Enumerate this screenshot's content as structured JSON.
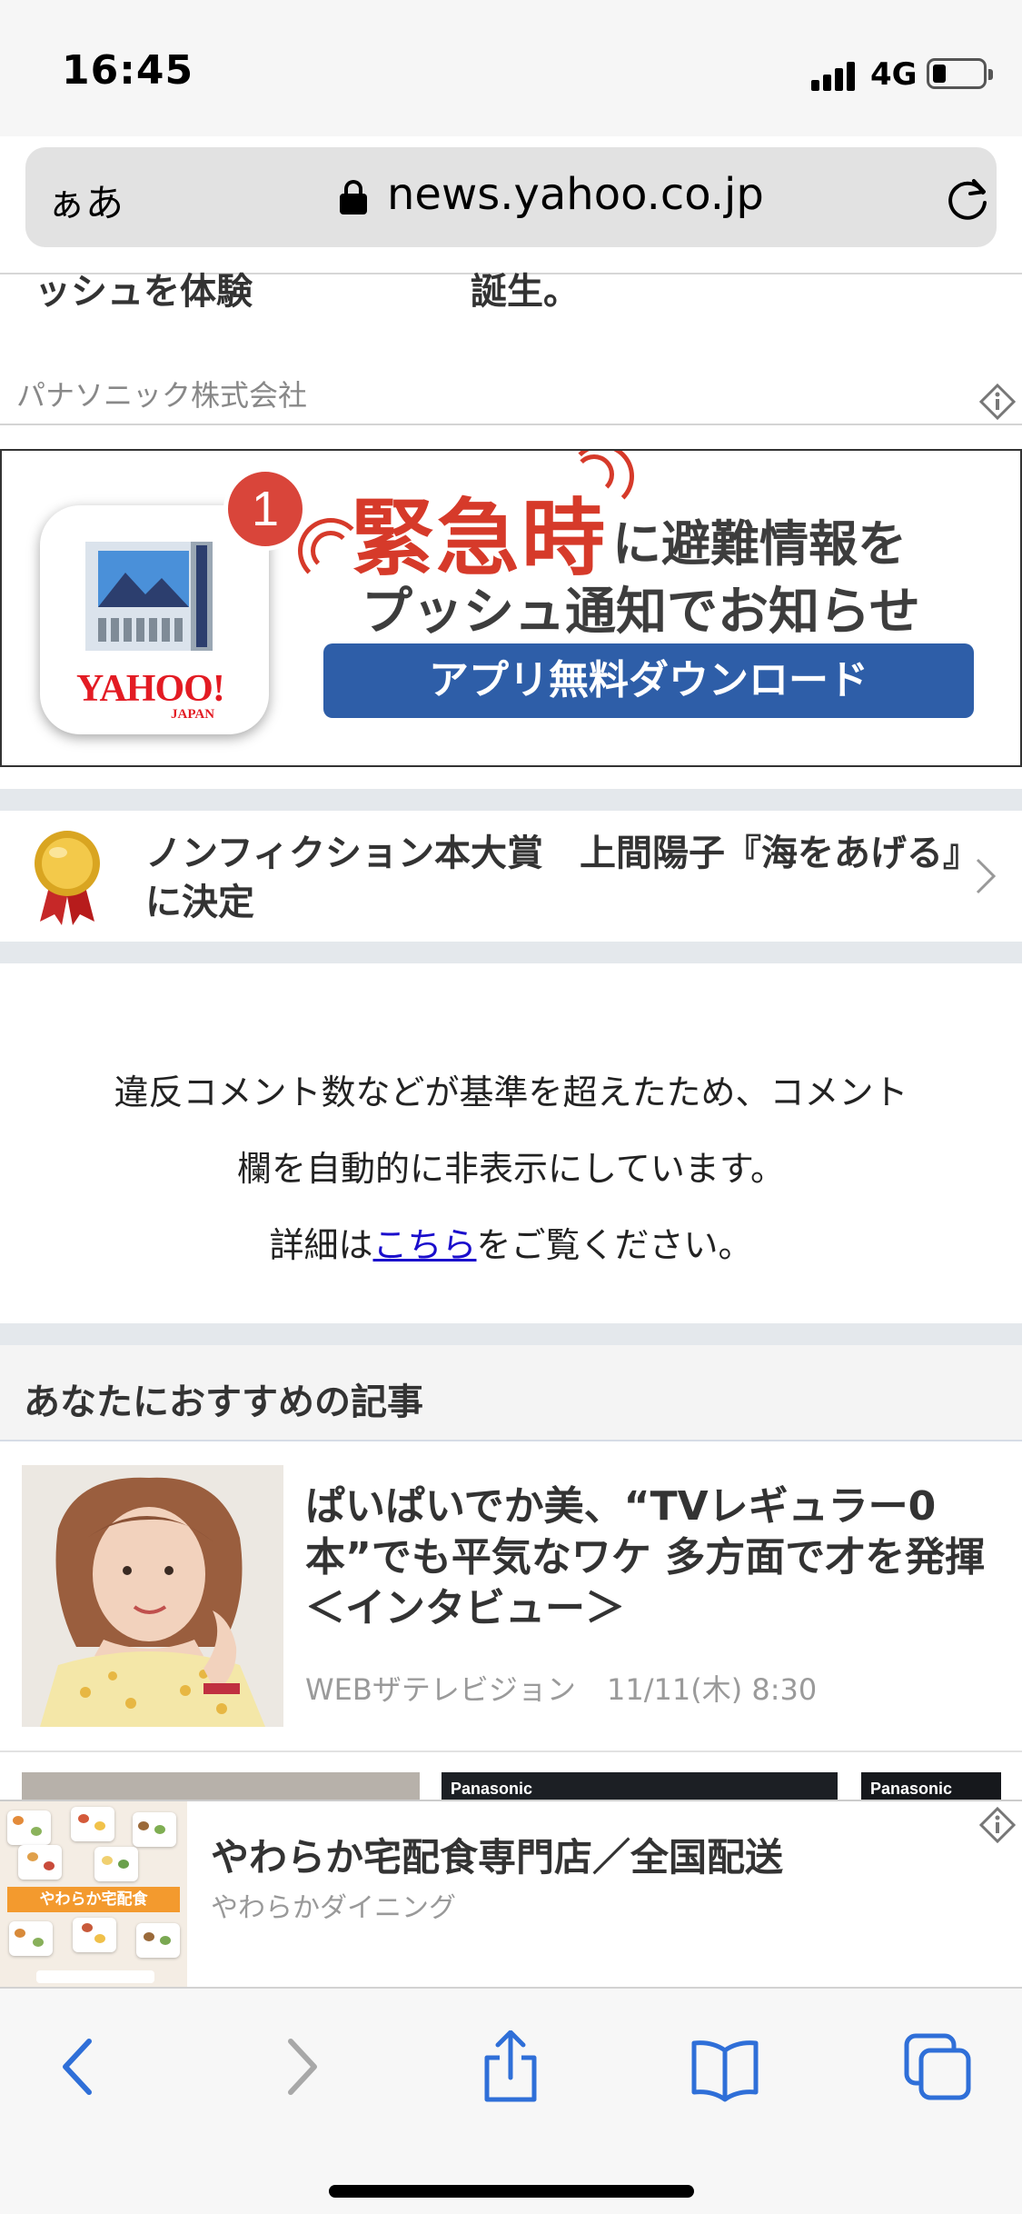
{
  "status_bar": {
    "time": "16:45",
    "network": "4G",
    "battery_level": 0.25
  },
  "browser": {
    "aa_label": "ぁあ",
    "url": "news.yahoo.co.jp",
    "icons": [
      "lock-icon",
      "reload-icon"
    ]
  },
  "clipped_article": {
    "left_fragment": "ッシュを体験",
    "right_fragment": "誕生。",
    "sponsor": "パナソニック株式会社"
  },
  "app_promo": {
    "badge_count": "1",
    "logo_text": "YAHOO!",
    "logo_sub": "JAPAN",
    "title_emphasis": "緊急時",
    "title_line1_rest": "に避難情報を",
    "title_line2": "プッシュ通知でお知らせ",
    "button_label": "アプリ無料ダウンロード",
    "colors": {
      "red": "#d63a2a",
      "button": "#2e5ea8"
    }
  },
  "award_link": {
    "text": "ノンフィクション本大賞　上間陽子『海をあげる』に決定",
    "icon": "medal-icon"
  },
  "comment_notice": {
    "line1": "違反コメント数などが基準を超えたため、コメント",
    "line2": "欄を自動的に非表示にしています。",
    "line3_prefix": "詳細は",
    "line3_link": "こちら",
    "line3_suffix": "をご覧ください。"
  },
  "recommended": {
    "section_title": "あなたにおすすめの記事",
    "article": {
      "headline": "ぱいぱいでか美、“TVレギュラー0本”でも平気なワケ 多方面で才を発揮＜インタビュー＞",
      "source": "WEBザテレビジョン",
      "date": "11/11(木) 8:30"
    },
    "carousel_labels": [
      "Panasonic",
      "Panasonic"
    ]
  },
  "bottom_ad": {
    "title": "やわらか宅配食専門店／全国配送",
    "advertiser": "やわらかダイニング",
    "image_banner": "やわらか宅配食"
  },
  "toolbar": {
    "buttons": [
      "back-icon",
      "forward-icon",
      "share-icon",
      "bookmarks-icon",
      "tabs-icon"
    ]
  }
}
